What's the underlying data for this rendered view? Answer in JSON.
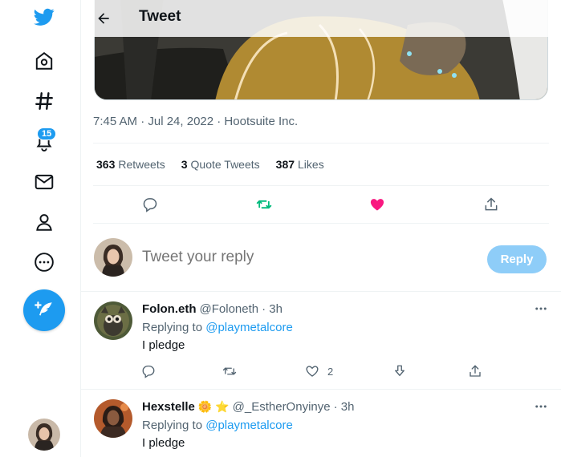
{
  "header": {
    "title": "Tweet"
  },
  "sidebar": {
    "notifications_badge": "15",
    "icons": [
      "twitter-logo-icon",
      "home-icon",
      "explore-hashtag-icon",
      "notifications-bell-icon",
      "messages-mail-icon",
      "profile-icon",
      "more-icon",
      "compose-tweet-icon"
    ]
  },
  "tweet": {
    "meta": "7:45 AM · Jul 24, 2022 · Hootsuite Inc.",
    "stats": {
      "retweets_count": "363",
      "retweets_label": "Retweets",
      "quotes_count": "3",
      "quotes_label": "Quote Tweets",
      "likes_count": "387",
      "likes_label": "Likes"
    },
    "liked": true,
    "retweeted": false
  },
  "compose_reply": {
    "placeholder": "Tweet your reply",
    "button_label": "Reply"
  },
  "replies": [
    {
      "name": "Folon.eth",
      "handle": "@Foloneth",
      "time": "· 3h",
      "replying_prefix": "Replying to",
      "replying_to": "@playmetalcore",
      "text": "I pledge",
      "like_count": "2"
    },
    {
      "name": "Hexstelle",
      "name_emoji": "🌼 ⭐",
      "handle": "@_EstherOnyinye",
      "time": "· 3h",
      "replying_prefix": "Replying to",
      "replying_to": "@playmetalcore",
      "text": "I pledge"
    }
  ],
  "colors": {
    "accent": "#1d9bf0",
    "retweet_green": "#00ba7c",
    "like_pink": "#f91880",
    "text_secondary": "#536471"
  }
}
